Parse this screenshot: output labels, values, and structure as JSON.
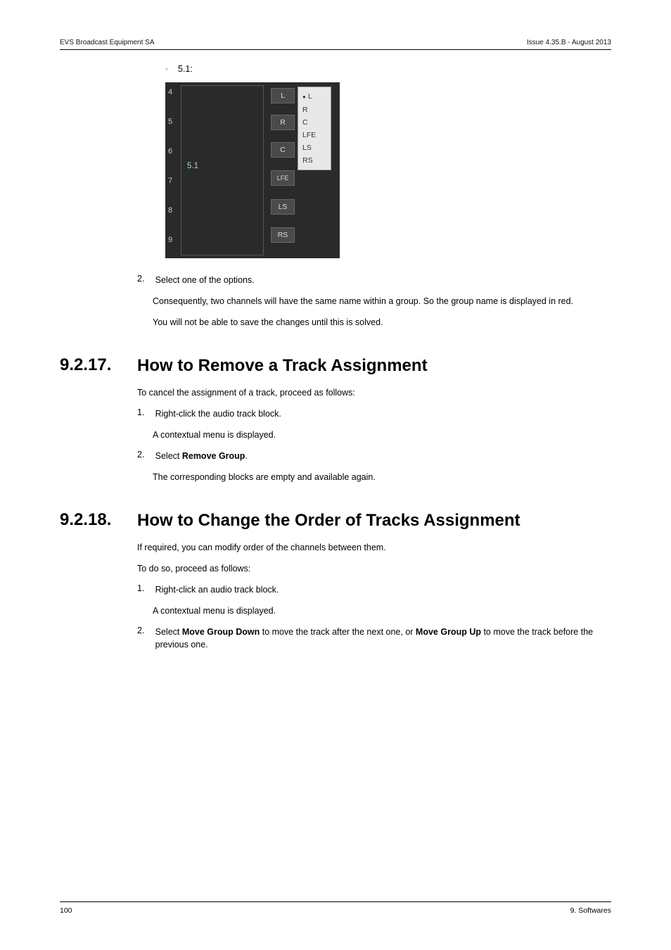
{
  "header": {
    "left": "EVS Broadcast Equipment SA",
    "right": "Issue 4.35.B - August 2013"
  },
  "bullet51": "5.1:",
  "panel": {
    "idx": [
      "4",
      "5",
      "6",
      "7",
      "8",
      "9"
    ],
    "big_label": "5.1",
    "small": {
      "L": "L",
      "R": "R",
      "C": "C",
      "LFE": "LFE",
      "LS": "LS",
      "RS": "RS"
    },
    "popup": [
      "L",
      "R",
      "C",
      "LFE",
      "LS",
      "RS"
    ]
  },
  "step2a_num": "2.",
  "step2a_txt": "Select one of the options.",
  "step2a_para1": "Consequently, two channels will have the same name within a group. So the group name is displayed in red.",
  "step2a_para2": "You will not be able to save the changes until this is solved.",
  "sec17": {
    "num": "9.2.17.",
    "title": "How to Remove a Track Assignment"
  },
  "sec17_p": "To cancel the assignment of a track, proceed as follows:",
  "sec17_s1_num": "1.",
  "sec17_s1_txt": "Right-click the audio track block.",
  "sec17_s1_ind": "A contextual menu is displayed.",
  "sec17_s2_num": "2.",
  "sec17_s2_pre": "Select ",
  "sec17_s2_bold": "Remove Group",
  "sec17_s2_post": ".",
  "sec17_s2_ind": "The corresponding blocks are empty and available again.",
  "sec18": {
    "num": "9.2.18.",
    "title": "How to Change the Order of Tracks Assignment"
  },
  "sec18_p1": "If required, you can modify order of the channels between them.",
  "sec18_p2": "To do so, proceed as follows:",
  "sec18_s1_num": "1.",
  "sec18_s1_txt": "Right-click an audio track block.",
  "sec18_s1_ind": "A contextual menu is displayed.",
  "sec18_s2_num": "2.",
  "sec18_s2_a": "Select ",
  "sec18_s2_b": "Move Group Down",
  "sec18_s2_c": " to move the track after the next one, or ",
  "sec18_s2_d": "Move Group Up",
  "sec18_s2_e": " to move the track before the previous one.",
  "footer": {
    "left": "100",
    "right": "9. Softwares"
  }
}
